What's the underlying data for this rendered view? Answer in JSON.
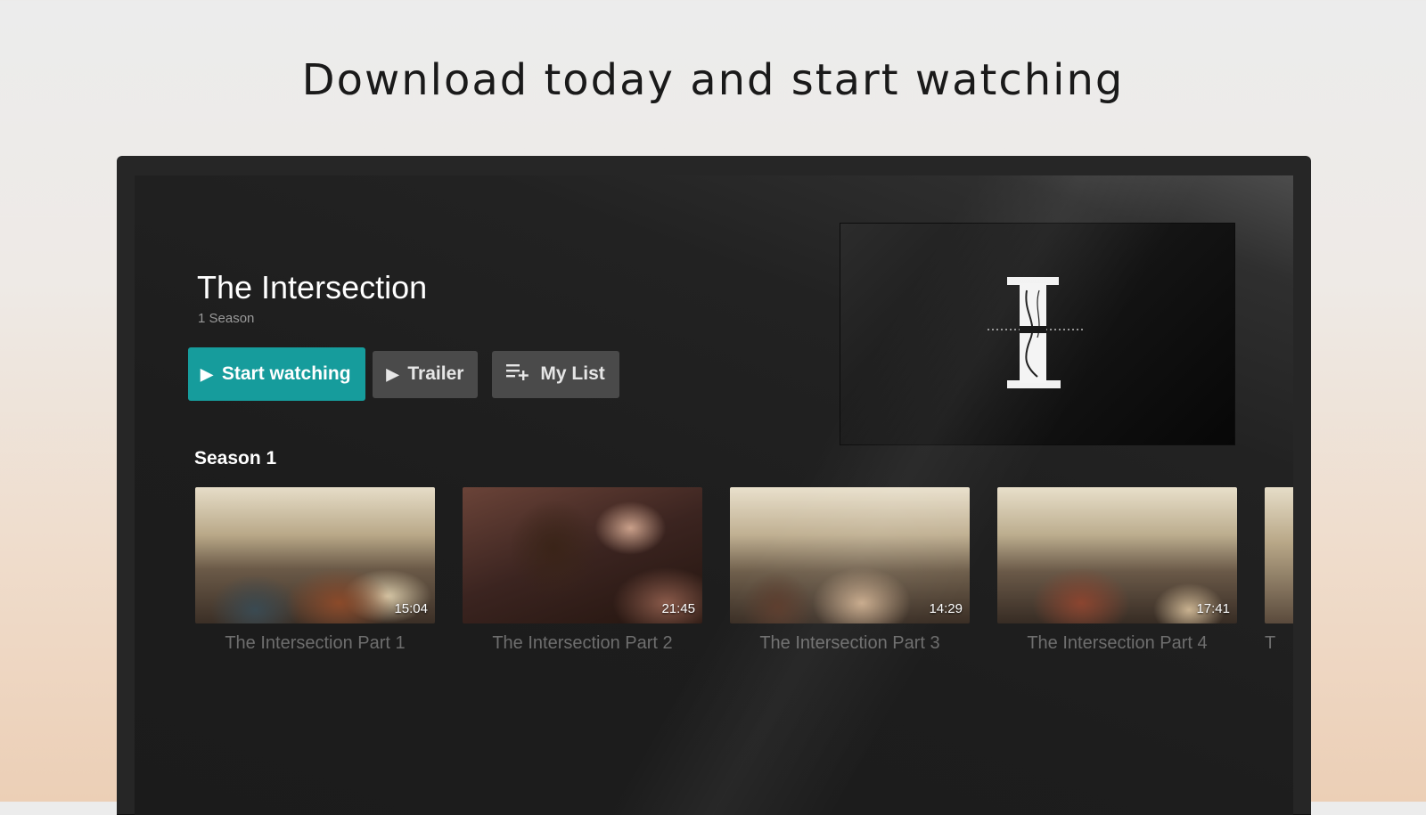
{
  "headline": "Download today and start watching",
  "show": {
    "title": "The Intersection",
    "meta": "1 Season"
  },
  "actions": {
    "start_label": "Start watching",
    "trailer_label": "Trailer",
    "mylist_label": "My List"
  },
  "icons": {
    "play": "play-icon",
    "add_to_list": "playlist-add-icon",
    "logo": "intersection-logo"
  },
  "colors": {
    "accent": "#169c9c",
    "screen_bg": "#1d1d1d",
    "secondary_button": "#4a4a4a"
  },
  "season": {
    "label": "Season 1",
    "episodes": [
      {
        "title": "The Intersection Part 1",
        "duration": "15:04"
      },
      {
        "title": "The Intersection Part 2",
        "duration": "21:45"
      },
      {
        "title": "The Intersection Part 3",
        "duration": "14:29"
      },
      {
        "title": "The Intersection Part 4",
        "duration": "17:41"
      },
      {
        "title": "T",
        "duration": ""
      }
    ]
  }
}
